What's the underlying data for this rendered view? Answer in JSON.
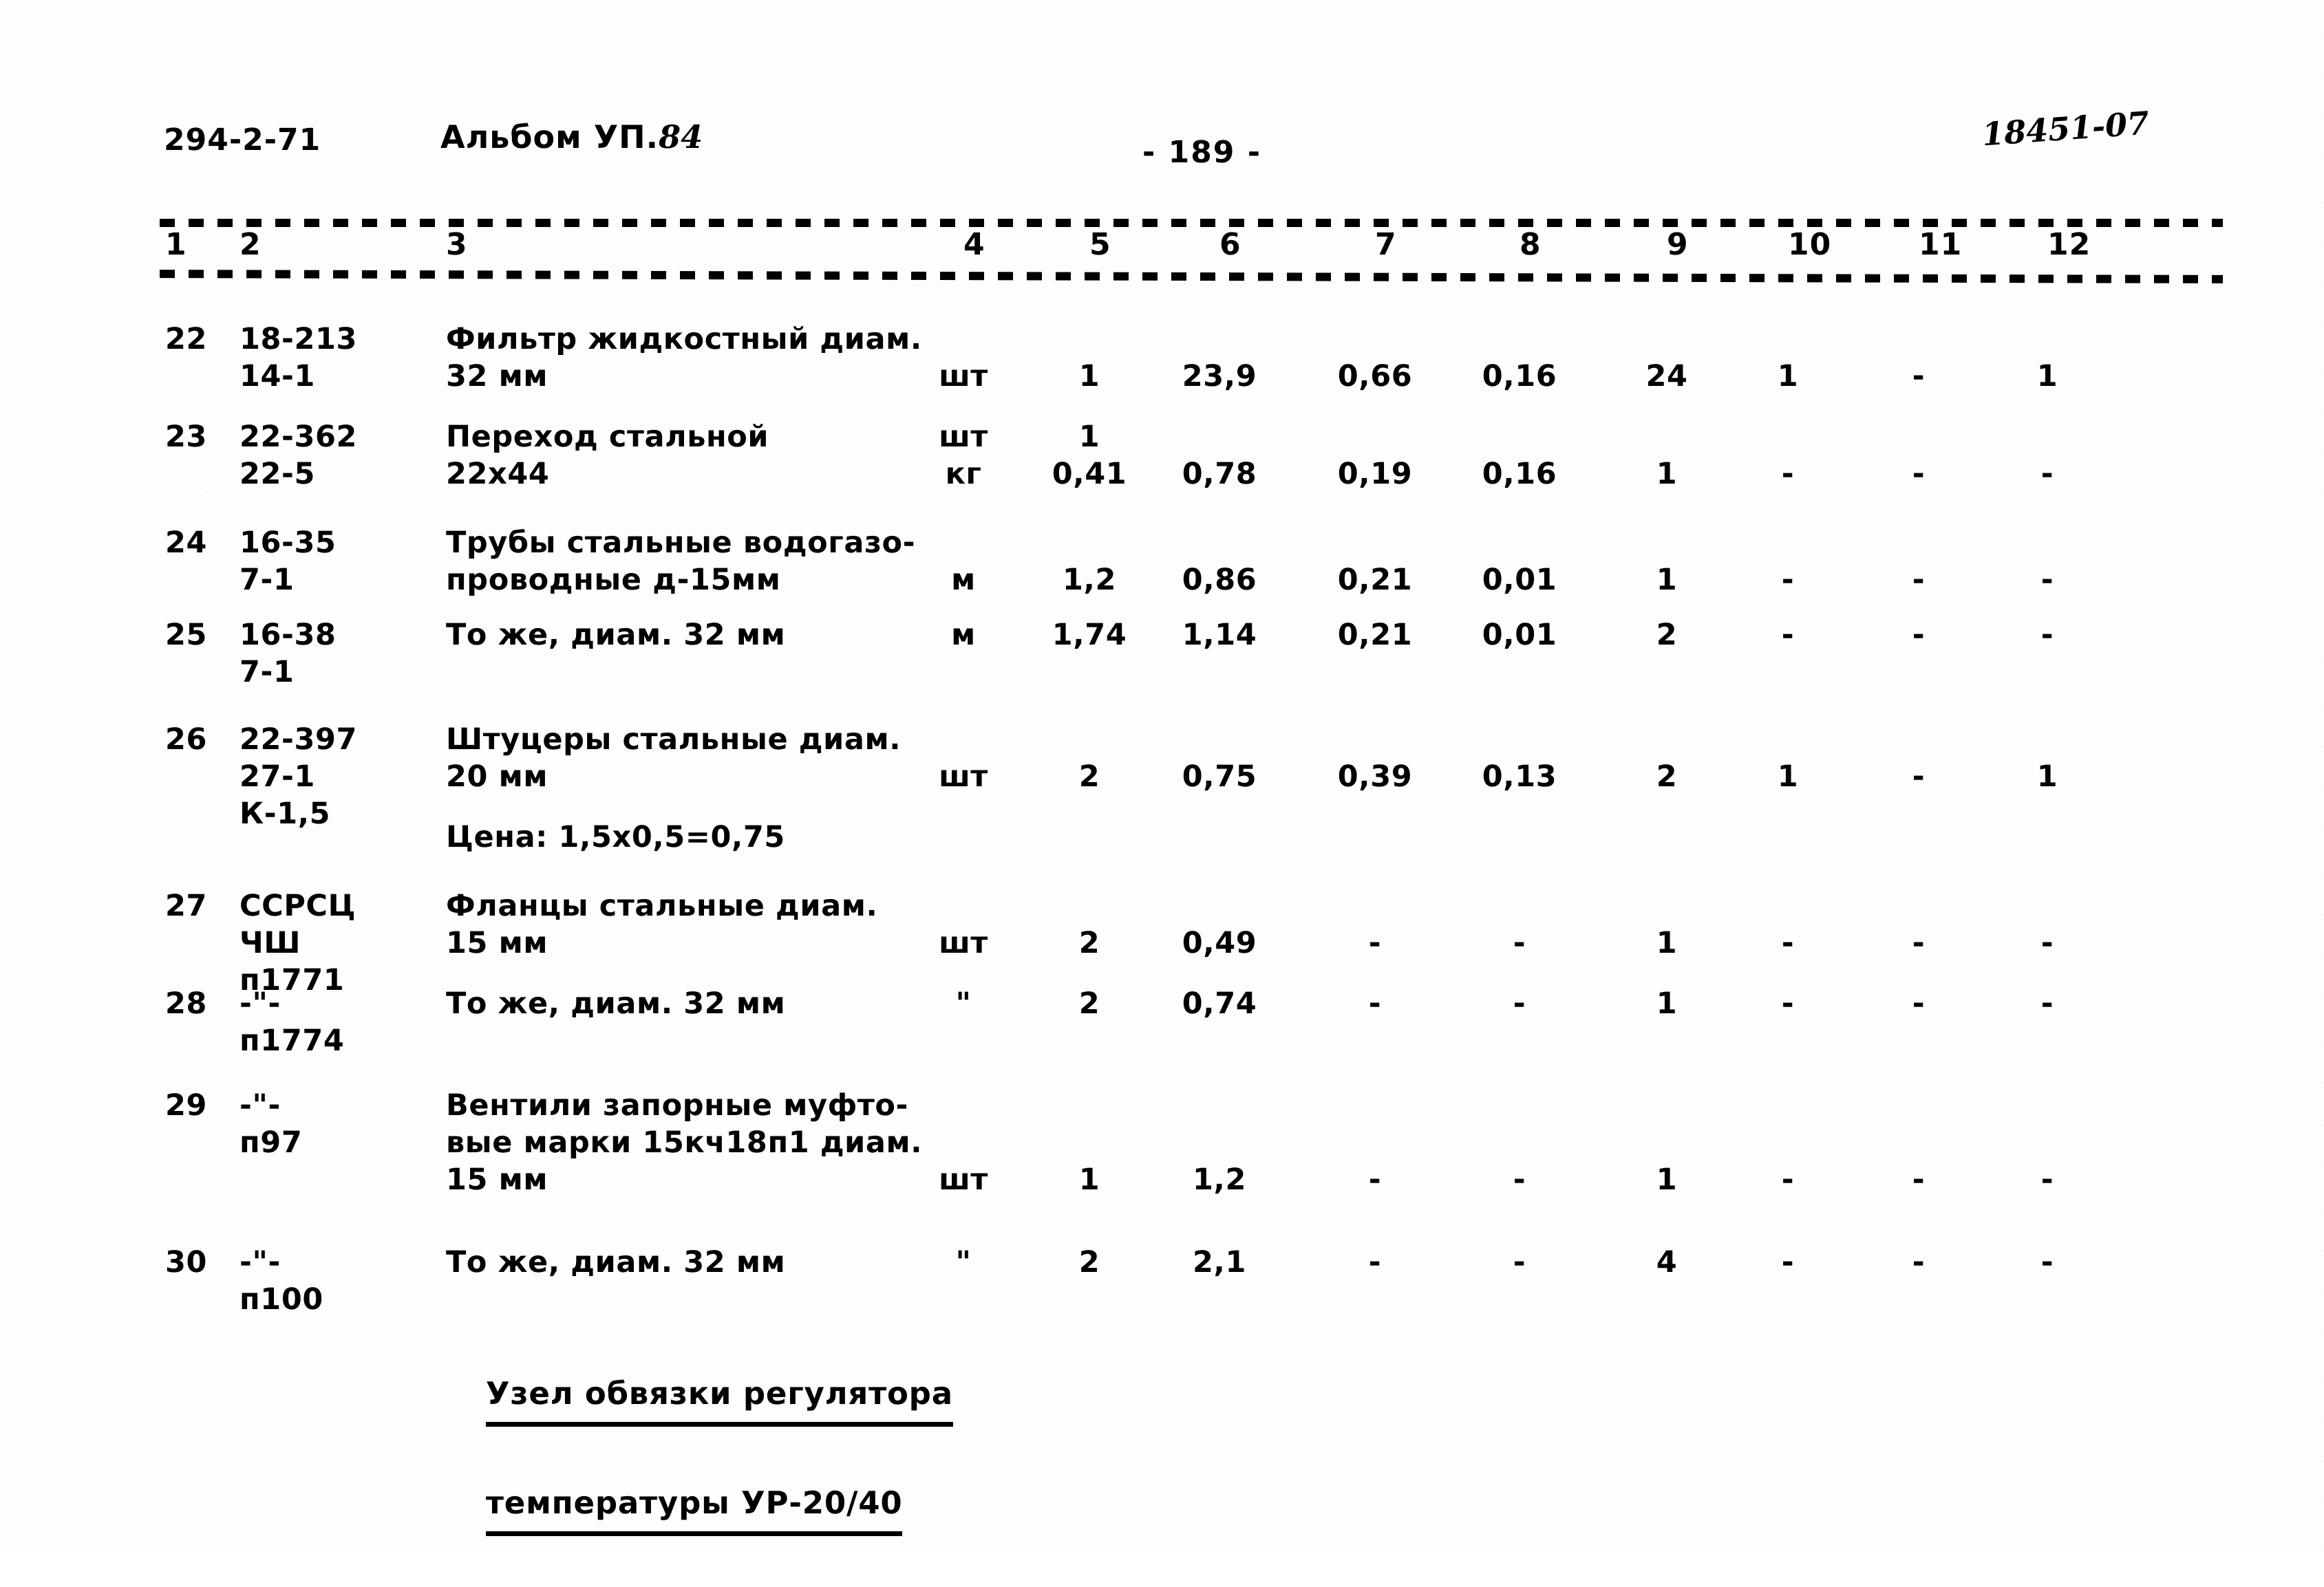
{
  "header": {
    "doc_code": "294-2-71",
    "album_label": "Альбом УП.",
    "album_number": "84",
    "page_number": "- 189 -",
    "stamp": "18451-07"
  },
  "table": {
    "column_numbers": [
      "1",
      "2",
      "3",
      "4",
      "5",
      "6",
      "7",
      "8",
      "9",
      "10",
      "11",
      "12"
    ],
    "rows": [
      {
        "no": "22",
        "code": "18-213\n14-1",
        "name": "Фильтр жидкостный диам.\n32 мм",
        "unit": "шт",
        "c5": "1",
        "c6": "23,9",
        "c7": "0,66",
        "c8": "0,16",
        "c9": "24",
        "c10": "1",
        "c11": "-",
        "c12": "1"
      },
      {
        "no": "23",
        "code": "22-362\n22-5",
        "name": "Переход стальной\n22х44",
        "unit": "шт\nкг",
        "c5": "1\n0,41",
        "c6": "0,78",
        "c7": "0,19",
        "c8": "0,16",
        "c9": "1",
        "c10": "-",
        "c11": "-",
        "c12": "-"
      },
      {
        "no": "24",
        "code": "16-35\n7-1",
        "name": "Трубы стальные водогазо-\nпроводные д-15мм",
        "unit": "м",
        "c5": "1,2",
        "c6": "0,86",
        "c7": "0,21",
        "c8": "0,01",
        "c9": "1",
        "c10": "-",
        "c11": "-",
        "c12": "-"
      },
      {
        "no": "25",
        "code": "16-38\n7-1",
        "name": "То же, диам. 32 мм",
        "unit": "м",
        "c5": "1,74",
        "c6": "1,14",
        "c7": "0,21",
        "c8": "0,01",
        "c9": "2",
        "c10": "-",
        "c11": "-",
        "c12": "-"
      },
      {
        "no": "26",
        "code": "22-397\n27-1\nК-1,5",
        "name": "Штуцеры стальные диам.\n20 мм",
        "note": "Цена: 1,5х0,5=0,75",
        "unit": "шт",
        "c5": "2",
        "c6": "0,75",
        "c7": "0,39",
        "c8": "0,13",
        "c9": "2",
        "c10": "1",
        "c11": "-",
        "c12": "1"
      },
      {
        "no": "27",
        "code": "ССРСЦ\nЧШ\nп1771",
        "name": "Фланцы стальные диам.\n15 мм",
        "unit": "шт",
        "c5": "2",
        "c6": "0,49",
        "c7": "-",
        "c8": "-",
        "c9": "1",
        "c10": "-",
        "c11": "-",
        "c12": "-"
      },
      {
        "no": "28",
        "code": "-\"-\nп1774",
        "name": "То же, диам. 32 мм",
        "unit": "\"",
        "c5": "2",
        "c6": "0,74",
        "c7": "-",
        "c8": "-",
        "c9": "1",
        "c10": "-",
        "c11": "-",
        "c12": "-"
      },
      {
        "no": "29",
        "code": "-\"-\nп97",
        "name": "Вентили запорные муфто-\nвые марки 15кч18п1 диам.\n15 мм",
        "unit": "шт",
        "c5": "1",
        "c6": "1,2",
        "c7": "-",
        "c8": "-",
        "c9": "1",
        "c10": "-",
        "c11": "-",
        "c12": "-"
      },
      {
        "no": "30",
        "code": "-\"-\nп100",
        "name": "То же, диам. 32 мм",
        "unit": "\"",
        "c5": "2",
        "c6": "2,1",
        "c7": "-",
        "c8": "-",
        "c9": "4",
        "c10": "-",
        "c11": "-",
        "c12": "-"
      }
    ]
  },
  "section_heading": {
    "line1": "Узел обвязки регулятора",
    "line2": "температуры УР-20/40"
  }
}
